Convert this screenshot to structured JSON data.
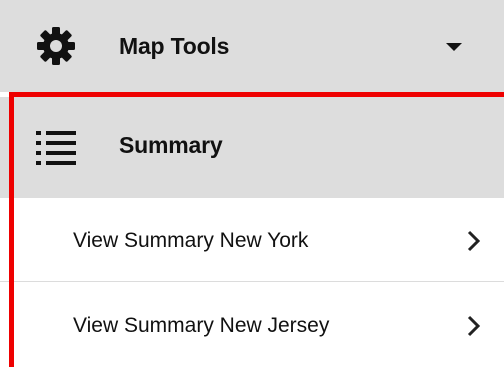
{
  "panel": {
    "map_tools": {
      "label": "Map Tools",
      "icon": "gear-icon",
      "state": "collapsed",
      "caret_icon": "caret-down-icon"
    },
    "summary": {
      "label": "Summary",
      "icon": "list-icon",
      "state": "expanded",
      "caret_icon": "caret-up-icon",
      "items": [
        {
          "label": "View Summary New York",
          "icon": "chevron-right-icon"
        },
        {
          "label": "View Summary New Jersey",
          "icon": "chevron-right-icon"
        }
      ]
    }
  },
  "colors": {
    "header_bg": "#dddddd",
    "item_bg": "#ffffff",
    "highlight": "#ee0000",
    "text": "#111111",
    "caret_muted": "#a8a8a8",
    "divider": "#dcdcdc"
  }
}
